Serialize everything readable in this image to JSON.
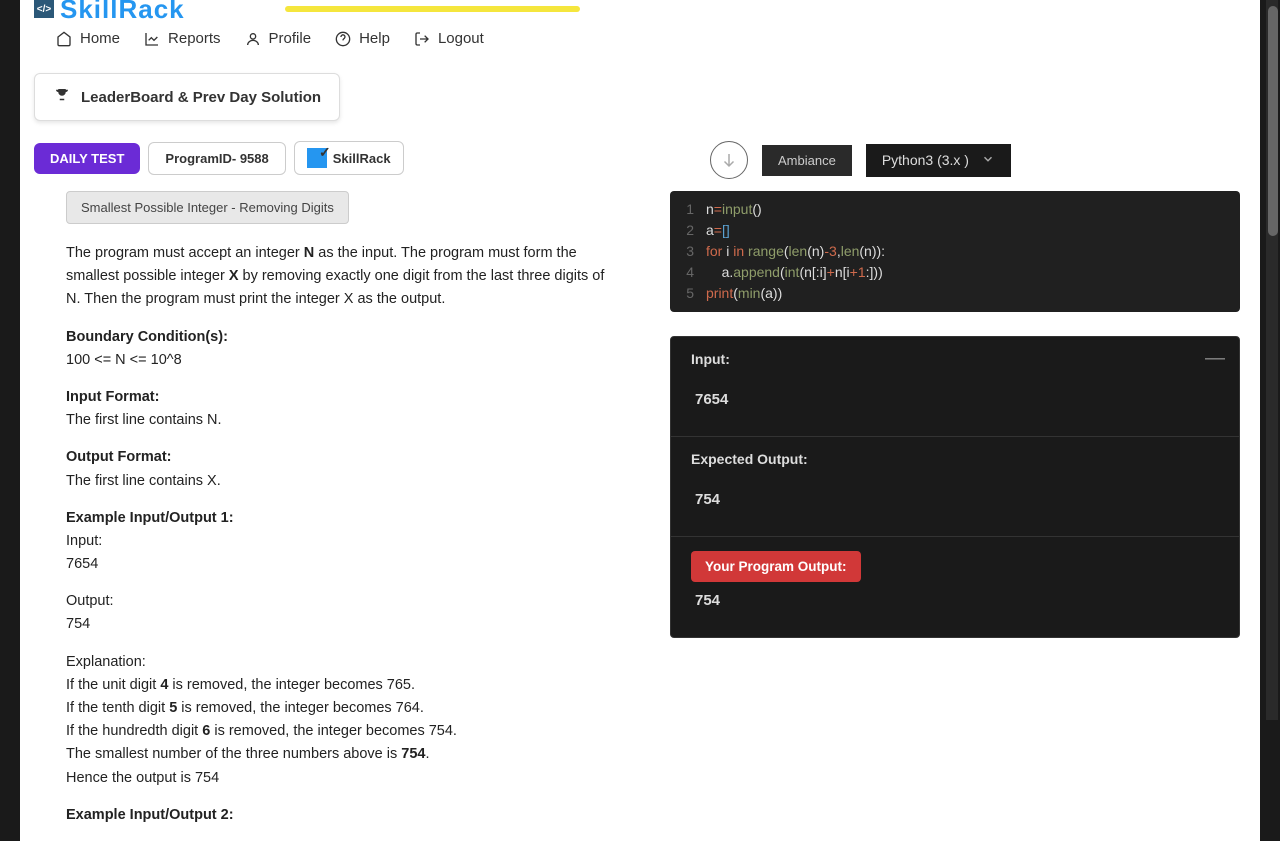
{
  "header": {
    "logo_tag": "</>",
    "logo_text": "SkillRack"
  },
  "nav": {
    "home": "Home",
    "reports": "Reports",
    "profile": "Profile",
    "help": "Help",
    "logout": "Logout"
  },
  "leaderboard_btn": "LeaderBoard & Prev Day Solution",
  "badges": {
    "daily_test": "DAILY TEST",
    "program_id": "ProgramID- 9588",
    "skillrack": "SkillRack"
  },
  "problem": {
    "title": "Smallest Possible Integer - Removing Digits",
    "intro_1": "The program must accept an integer ",
    "intro_bold_N": "N",
    "intro_2": " as the input. The program must form the smallest possible integer ",
    "intro_bold_X": "X",
    "intro_3": " by removing exactly one digit from the last three digits of N. Then the program must print the integer X as the output.",
    "boundary_title": "Boundary Condition(s):",
    "boundary_text": "100 <= N <= 10^8",
    "input_format_title": "Input Format:",
    "input_format_text": "The first line contains N.",
    "output_format_title": "Output Format:",
    "output_format_text": "The first line contains X.",
    "ex1_title": "Example Input/Output 1:",
    "ex1_input_label": "Input:",
    "ex1_input": "7654",
    "ex1_output_label": "Output:",
    "ex1_output": "754",
    "ex1_explain_label": "Explanation:",
    "ex1_line1a": "If the unit digit ",
    "ex1_line1b": "4",
    "ex1_line1c": " is removed, the integer becomes 765.",
    "ex1_line2a": "If the tenth digit ",
    "ex1_line2b": "5",
    "ex1_line2c": " is removed, the integer becomes 764.",
    "ex1_line3a": "If the hundredth digit ",
    "ex1_line3b": "6",
    "ex1_line3c": " is removed, the integer becomes 754.",
    "ex1_line4a": "The smallest number of the three numbers above is ",
    "ex1_line4b": "754",
    "ex1_line4c": ".",
    "ex1_line5": "Hence the output is 754",
    "ex2_title": "Example Input/Output 2:"
  },
  "editor": {
    "theme": "Ambiance",
    "language": "Python3 (3.x )",
    "lines": [
      "1",
      "2",
      "3",
      "4",
      "5"
    ]
  },
  "output": {
    "input_label": "Input:",
    "input_value": "7654",
    "expected_label": "Expected Output:",
    "expected_value": "754",
    "your_output_label": "Your Program Output:",
    "your_output_value": "754"
  }
}
